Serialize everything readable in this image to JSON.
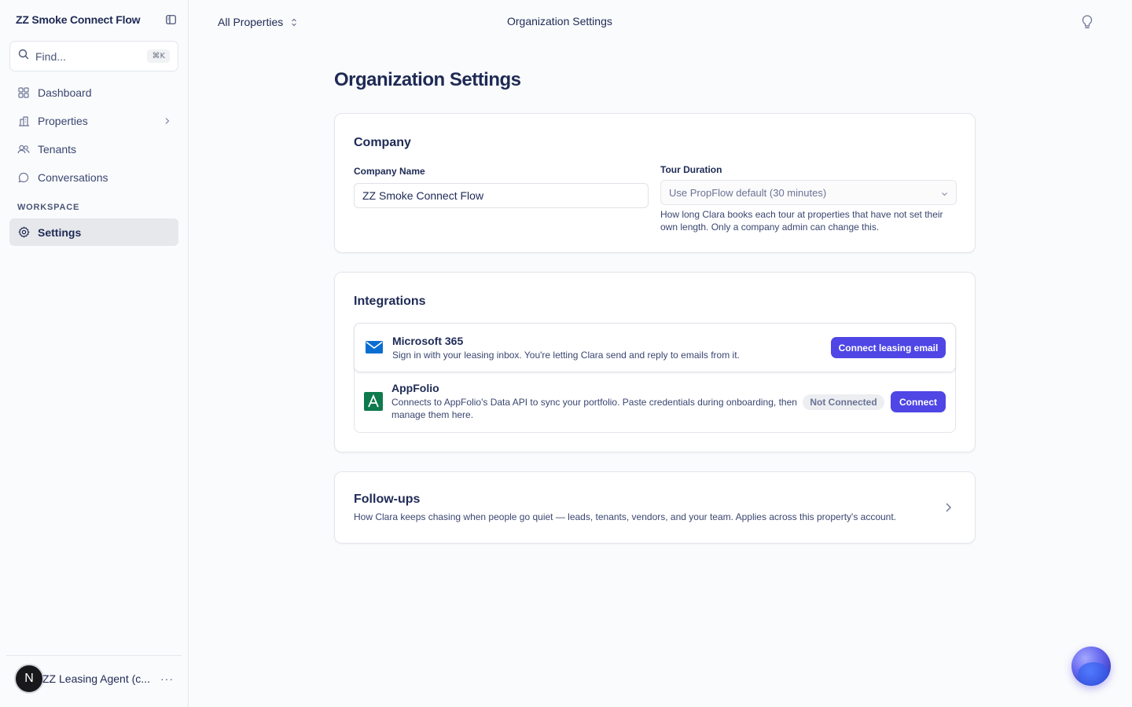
{
  "sidebar": {
    "org_name": "ZZ Smoke Connect Flow",
    "search_placeholder": "Find...",
    "search_shortcut": "⌘K",
    "nav": [
      {
        "label": "Dashboard",
        "icon": "grid-icon"
      },
      {
        "label": "Properties",
        "icon": "building-icon"
      },
      {
        "label": "Tenants",
        "icon": "users-icon"
      },
      {
        "label": "Conversations",
        "icon": "chat-icon"
      }
    ],
    "section_label": "WORKSPACE",
    "settings_label": "Settings",
    "user_initial": "N",
    "user_name": "ZZ Leasing Agent (c...",
    "more": "···"
  },
  "topbar": {
    "property_switcher": "All Properties",
    "title": "Organization Settings"
  },
  "main": {
    "page_title": "Organization Settings",
    "company": {
      "title": "Company",
      "company_name_label": "Company Name",
      "company_name_value": "ZZ Smoke Connect Flow",
      "tour_duration_label": "Tour Duration",
      "tour_duration_value": "Use PropFlow default (30 minutes)",
      "tour_duration_help": "How long Clara books each tour at properties that have not set their own length. Only a company admin can change this."
    },
    "integrations": {
      "title": "Integrations",
      "items": [
        {
          "name": "Microsoft 365",
          "description": "Sign in with your leasing inbox. You're letting Clara send and reply to emails from it.",
          "button": "Connect leasing email"
        },
        {
          "name": "AppFolio",
          "description": "Connects to AppFolio's Data API to sync your portfolio. Paste credentials during onboarding, then manage them here.",
          "status": "Not Connected",
          "button": "Connect"
        }
      ]
    },
    "followups": {
      "title": "Follow-ups",
      "description": "How Clara keeps chasing when people go quiet — leads, tenants, vendors, and your team. Applies across this property's account."
    }
  },
  "colors": {
    "accent": "#4f46e5",
    "text": "#1e2a55",
    "microsoft_blue": "#0a6ed1",
    "appfolio_green": "#0f7a4c"
  }
}
